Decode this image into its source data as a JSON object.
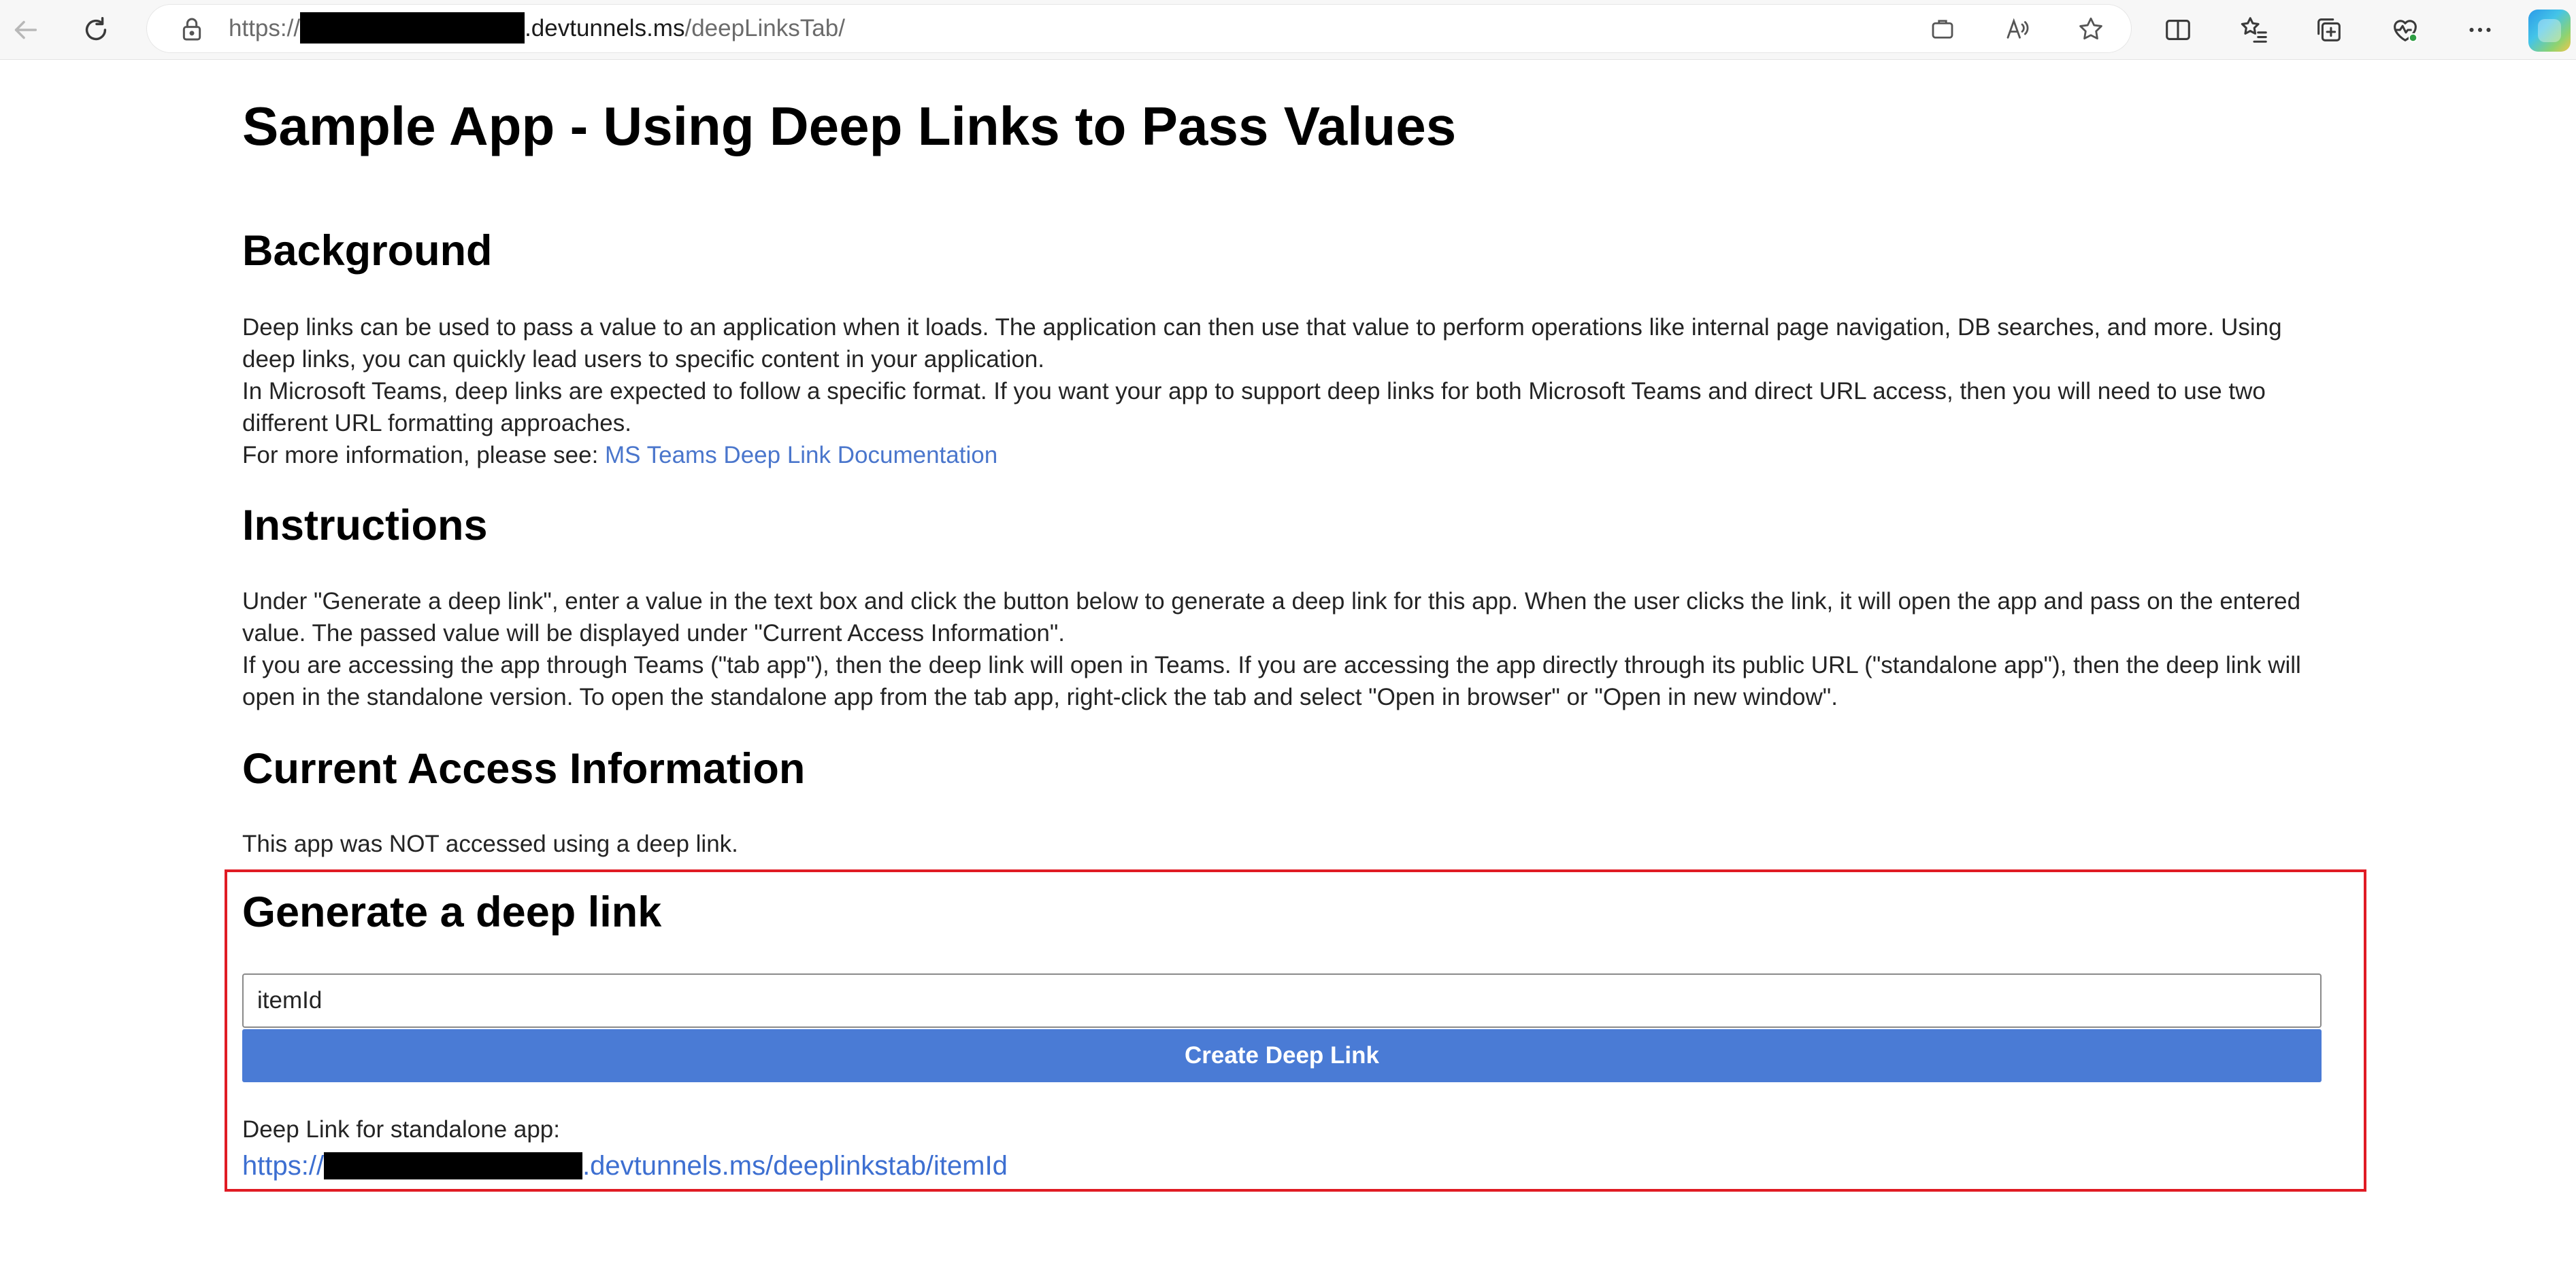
{
  "browser": {
    "url_scheme": "https://",
    "url_host_suffix": ".devtunnels.ms",
    "url_path": "/deepLinksTab/"
  },
  "page": {
    "title": "Sample App - Using Deep Links to Pass Values",
    "background": {
      "heading": "Background",
      "p1": "Deep links can be used to pass a value to an application when it loads. The application can then use that value to perform operations like internal page navigation, DB searches, and more. Using deep links, you can quickly lead users to specific content in your application.",
      "p2": "In Microsoft Teams, deep links are expected to follow a specific format. If you want your app to support deep links for both Microsoft Teams and direct URL access, then you will need to use two different URL formatting approaches.",
      "p3_prefix": "For more information, please see: ",
      "doc_link": "MS Teams Deep Link Documentation"
    },
    "instructions": {
      "heading": "Instructions",
      "p1": "Under \"Generate a deep link\", enter a value in the text box and click the button below to generate a deep link for this app. When the user clicks the link, it will open the app and pass on the entered value. The passed value will be displayed under \"Current Access Information\".",
      "p2": "If you are accessing the app through Teams (\"tab app\"), then the deep link will open in Teams. If you are accessing the app directly through its public URL (\"standalone app\"), then the deep link will open in the standalone version. To open the standalone app from the tab app, right-click the tab and select \"Open in browser\" or \"Open in new window\"."
    },
    "current_access": {
      "heading": "Current Access Information",
      "status": "This app was NOT accessed using a deep link."
    },
    "generate": {
      "heading": "Generate a deep link",
      "input_value": "itemId",
      "button_label": "Create Deep Link",
      "result_label": "Deep Link for standalone app:",
      "result_link_prefix": "https://",
      "result_link_suffix": ".devtunnels.ms/deeplinkstab/itemId"
    }
  },
  "colors": {
    "link": "#4a76cc",
    "button": "#4a7bd5",
    "highlight_border": "#e01b24"
  }
}
